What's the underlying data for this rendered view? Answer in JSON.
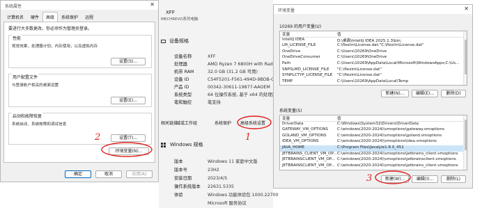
{
  "sysprops": {
    "title": "系统属性",
    "close": "✕",
    "tabs": [
      "计算机名",
      "硬件",
      "高级",
      "系统保护",
      "远程"
    ],
    "note": "要进行大多数更改，你必须作为管理员登录。",
    "perf": {
      "title": "性能",
      "desc": "视觉效果，处理器计划，内存使用，以及虚拟内存",
      "button": "设置(S)..."
    },
    "profile": {
      "title": "用户配置文件",
      "desc": "与登录帐户相关的桌面设置",
      "button": "设置(E)..."
    },
    "startup": {
      "title": "启动和故障恢复",
      "desc": "系统启动、系统故障和调试信息",
      "button": "设置(T)..."
    },
    "envbutton": "环境变量(N)...",
    "ok": "确定",
    "cancel": "取消",
    "apply": "应用(A)"
  },
  "sysinfo": {
    "pc_name": "XFF",
    "pc_model": "MECHREVO系列电脑",
    "device_section": "设备规格",
    "device": [
      {
        "k": "设备名称",
        "v": "XFF"
      },
      {
        "k": "处理器",
        "v": "AMD Ryzen 7 6800H with Radeon"
      },
      {
        "k": "机带 RAM",
        "v": "32.0 GB (31.2 GB 可用)"
      },
      {
        "k": "设备 ID",
        "v": "C54F5201-F561-494D-9BDB-C4B"
      },
      {
        "k": "产品 ID",
        "v": "00342-30611-19877-AAOEM"
      },
      {
        "k": "系统类型",
        "v": "64 位操作系统, 基于 x64 的处理器"
      },
      {
        "k": "笔和触控",
        "v": "笔支持"
      }
    ],
    "links": [
      "相关链接",
      "域或工作组",
      "系统保护",
      "高级系统设置"
    ],
    "windows_section": "Windows 规格",
    "windows": [
      {
        "k": "版本",
        "v": "Windows 11 家庭中文版"
      },
      {
        "k": "版本号",
        "v": "23H2"
      },
      {
        "k": "安装日期",
        "v": "2023/4/5"
      },
      {
        "k": "操作系统版本",
        "v": "22631.5335"
      },
      {
        "k": "体验",
        "v": "Windows 功能体验包 1000.22700"
      },
      {
        "k": "",
        "v": "Microsoft 服务协议"
      }
    ]
  },
  "envvars": {
    "title": "环境变量",
    "close": "✕",
    "user_label": "10269 的用户变量(U)",
    "col_var": "变量",
    "col_val": "值",
    "user_vars": [
      {
        "n": "IntelliJ IDEA",
        "v": "D:\\桌面\\IntelliJ IDEA 2025.1.3\\bin;"
      },
      {
        "n": "LM_LICENSE_FILE",
        "v": "C:\\flexlm\\License.dat;\"C:\\flexlm\\License.dat\""
      },
      {
        "n": "OneDrive",
        "v": "C:\\Users\\10269\\OneDrive"
      },
      {
        "n": "OneDriveConsumer",
        "v": "C:\\Users\\10269\\OneDrive"
      },
      {
        "n": "Path",
        "v": "C:\\Users\\10269\\AppData\\Local\\Microsoft\\WindowsApps;C:\\Us..."
      },
      {
        "n": "SNPSLMD_LICENSE_FILE",
        "v": "\"C:\\flexlm\\License.dat\""
      },
      {
        "n": "SYNPLCTYP_LICENSE_FILE",
        "v": "\"C:\\flexlm\\License.dat\""
      },
      {
        "n": "TEMP",
        "v": "C:\\Users\\10269\\AppData\\Local\\Temp"
      }
    ],
    "user_buttons": [
      "新建(N)...",
      "编辑(E)...",
      "删除(D)"
    ],
    "sys_label": "系统变量(S)",
    "sys_vars": [
      {
        "n": "DriverData",
        "v": "C:\\Windows\\System32\\Drivers\\DriverData"
      },
      {
        "n": "GATEWAY_VM_OPTIONS",
        "v": "C:\\windows(2020-2024)\\vmoptions\\gateway.vmoptions"
      },
      {
        "n": "GOLAND_VM_OPTIONS",
        "v": "C:\\windows(2020-2024)\\vmoptions\\goland.vmoptions"
      },
      {
        "n": "IDEA_VM_OPTIONS",
        "v": "C:\\windows(2020-2024)\\vmoptions\\idea.vmoptions"
      },
      {
        "n": "JAVA_HOME",
        "v": "C:\\Program Files\\Java\\jre1.8.0_451"
      },
      {
        "n": "JETBRAINS_CLIENT_VM_OP...",
        "v": "C:\\windows(2020-2024)\\vmoptions\\jetbrains_client.vmoptions"
      },
      {
        "n": "JETBRAINSCLIENT_VM_OP...",
        "v": "C:\\windows(2020-2024)\\vmoptions\\jetbrainsclient.vmoptions"
      },
      {
        "n": "JETBRAINSCLIENT_VM_OP...",
        "v": "C:\\windows(2020-2024)\\vmoptions\\jetbrains_client.vmoptions"
      }
    ],
    "sys_buttons": [
      "新建(W)...",
      "编辑(I)...",
      "删除(L)"
    ]
  },
  "annotations": [
    "2",
    "1",
    "3"
  ],
  "colors": {
    "annotation": "#e0211d",
    "accent": "#0067c0",
    "selection": "#cce4f7"
  }
}
